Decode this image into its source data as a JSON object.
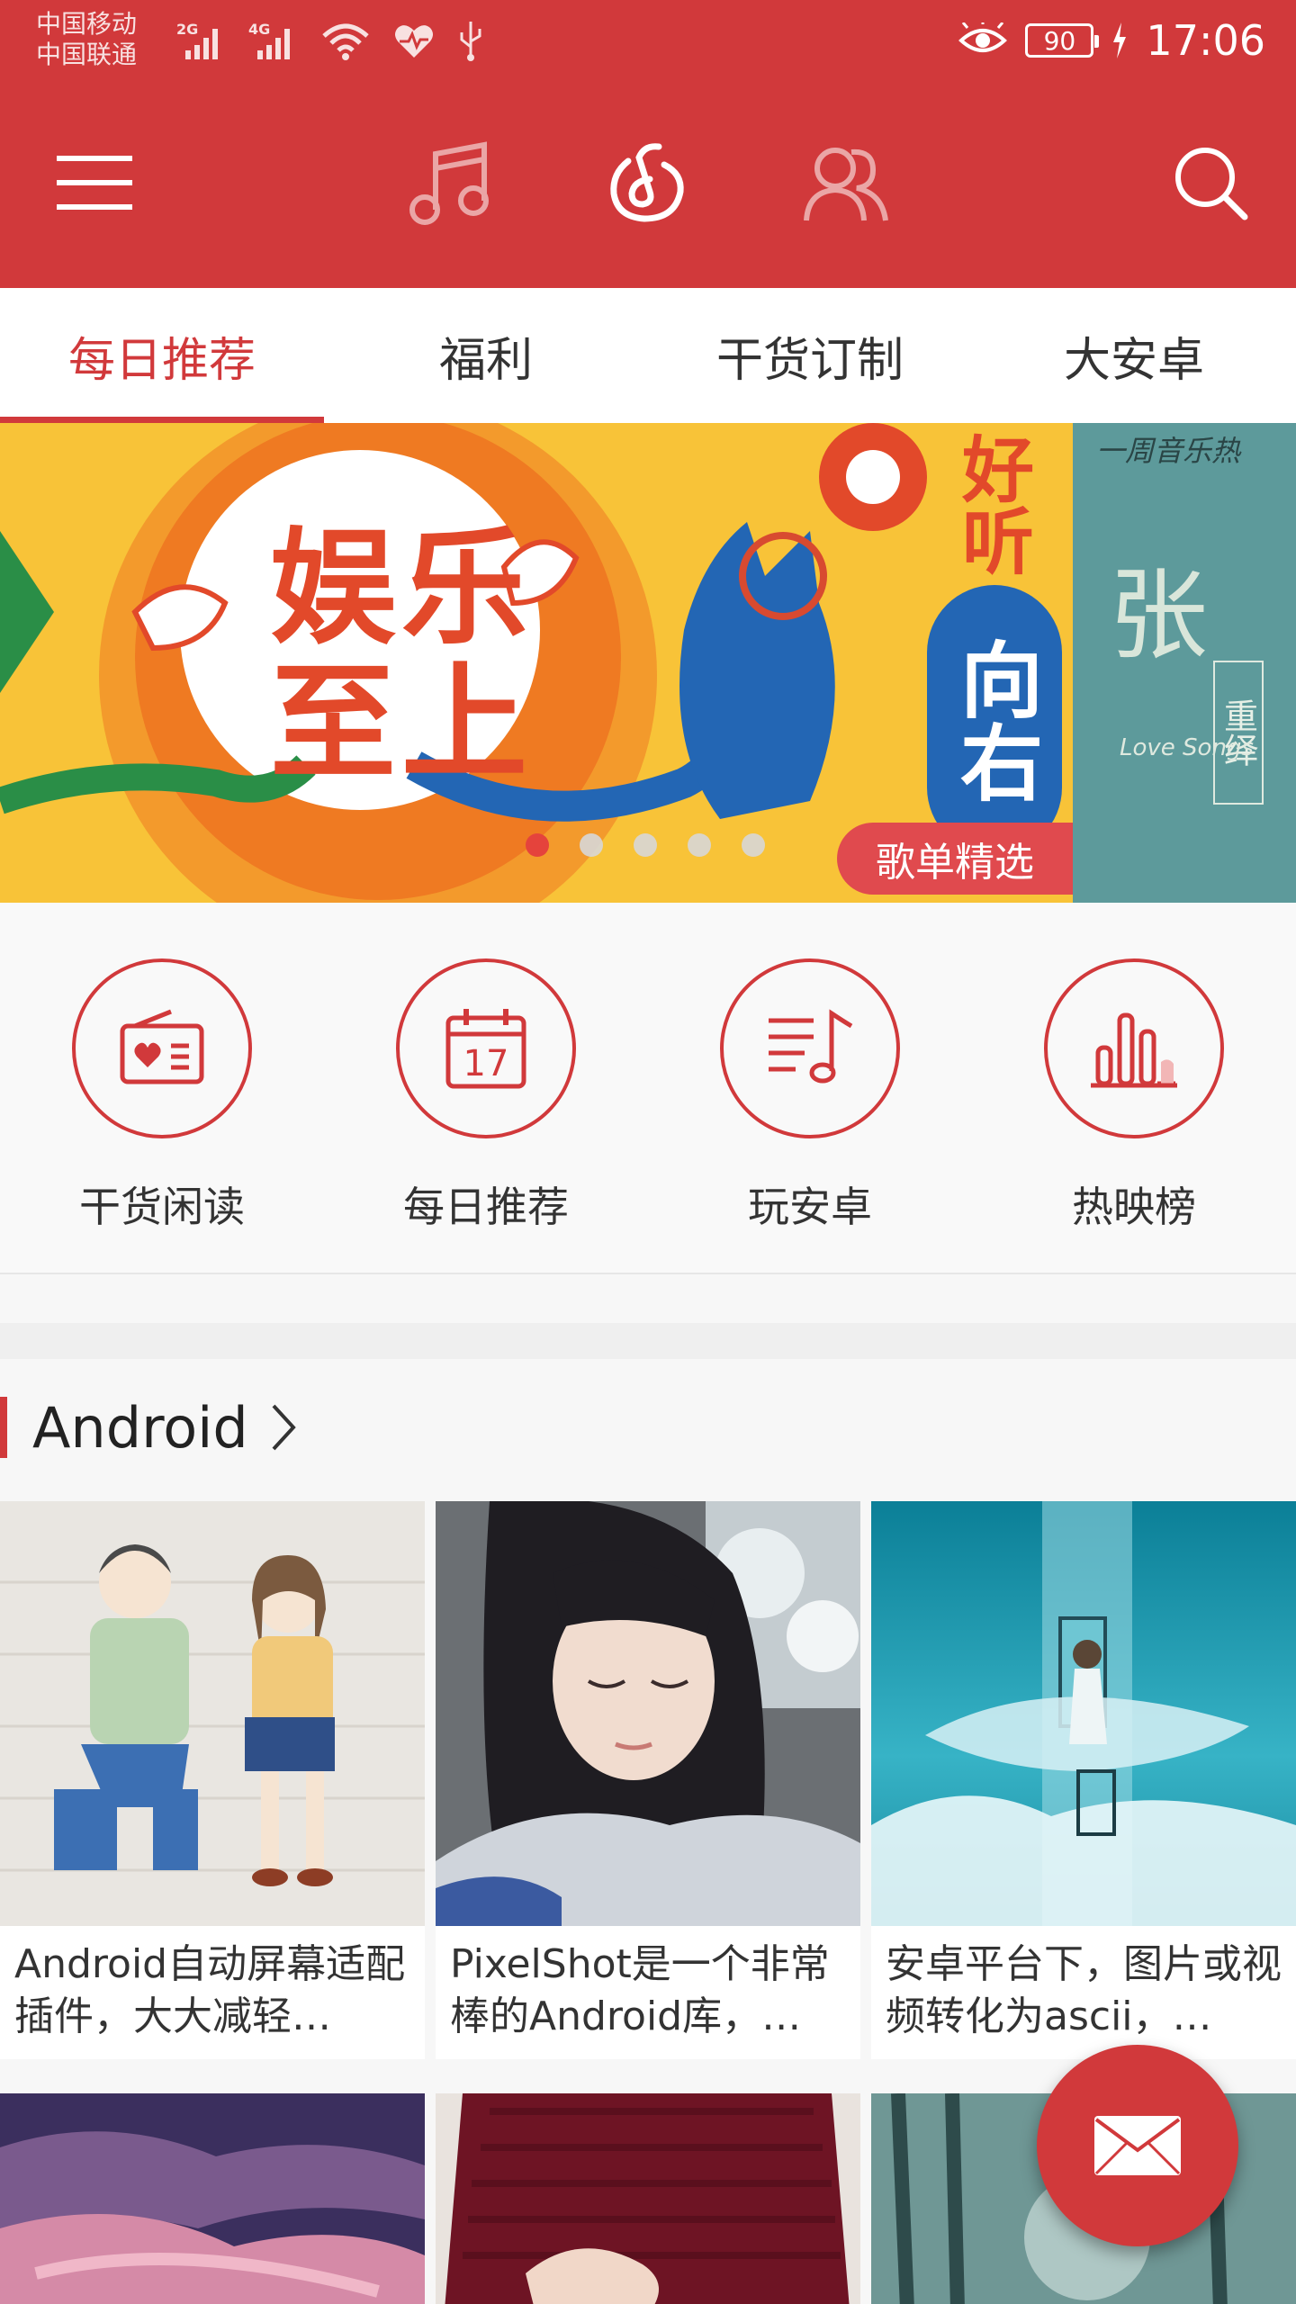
{
  "status_bar": {
    "carrier_1": "中国移动",
    "carrier_2": "中国联通",
    "net_1": "2G",
    "net_2": "4G",
    "battery": "90",
    "time": "17:06"
  },
  "toolbar": {
    "icons": [
      "menu-icon",
      "music-note-icon",
      "netease-music-icon",
      "friends-icon",
      "search-icon"
    ],
    "active_icon": "netease-music-icon"
  },
  "tabs": [
    {
      "label": "每日推荐",
      "active": true
    },
    {
      "label": "福利",
      "active": false
    },
    {
      "label": "干货订制",
      "active": false
    },
    {
      "label": "大安卓",
      "active": false
    }
  ],
  "banner": {
    "hero_text_1": "娱乐",
    "hero_text_2": "至上",
    "side_text": "好听",
    "badge_text": "向右",
    "playlist_label": "歌单精选",
    "next_title": "一周音乐热",
    "next_name": "张 信",
    "next_tag": "重绎",
    "next_script": "Love Songs",
    "dot_count": 5,
    "active_dot": 0
  },
  "quick_entries": [
    {
      "label": "干货闲读",
      "icon": "radio-heart-icon"
    },
    {
      "label": "每日推荐",
      "icon": "calendar-icon",
      "icon_text": "17"
    },
    {
      "label": "玩安卓",
      "icon": "playlist-icon"
    },
    {
      "label": "热映榜",
      "icon": "bar-chart-icon"
    }
  ],
  "section": {
    "title": "Android"
  },
  "cards": [
    {
      "title": "Android自动屏幕适配插件，大大减轻…"
    },
    {
      "title": "PixelShot是一个非常棒的Android库，…"
    },
    {
      "title": "安卓平台下，图片或视频转化为ascii，…"
    }
  ],
  "fab": {
    "icon": "mail-icon"
  },
  "colors": {
    "primary": "#d1393b",
    "tab_active": "#d1393b",
    "banner_bg": "#f8c338"
  }
}
